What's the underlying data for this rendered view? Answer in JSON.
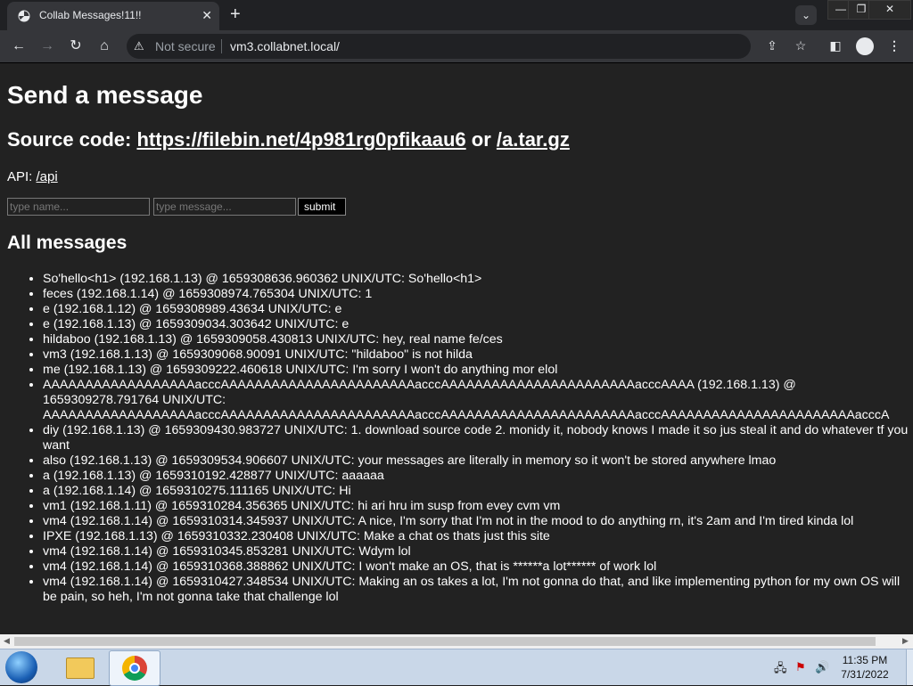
{
  "browser": {
    "tab_title": "Collab Messages!11!!",
    "tab_close": "✕",
    "new_tab": "+",
    "not_secure": "Not secure",
    "url": "vm3.collabnet.local/"
  },
  "page": {
    "heading": "Send a message",
    "source_prefix": "Source code: ",
    "source_link": "https://filebin.net/4p981rg0pfikaau6",
    "source_or": " or ",
    "tar_link": "/a.tar.gz",
    "api_prefix": "API: ",
    "api_link": "/api",
    "name_placeholder": "type name...",
    "message_placeholder": "type message...",
    "submit_label": "submit",
    "all_messages_heading": "All messages",
    "messages": [
      "So'hello<h1> (192.168.1.13) @ 1659308636.960362 UNIX/UTC: So'hello<h1>",
      "feces (192.168.1.14) @ 1659308974.765304 UNIX/UTC: 1",
      "e (192.168.1.12) @ 1659308989.43634 UNIX/UTC: e",
      "e (192.168.1.13) @ 1659309034.303642 UNIX/UTC: e",
      "hildaboo (192.168.1.13) @ 1659309058.430813 UNIX/UTC: hey, real name fe/ces",
      "vm3 (192.168.1.13) @ 1659309068.90091 UNIX/UTC: \"hildaboo\" is not hilda",
      "me (192.168.1.13) @ 1659309222.460618 UNIX/UTC: I'm sorry I won't do anything mor elol",
      "AAAAAAAAAAAAAAAAAAacccAAAAAAAAAAAAAAAAAAAAAAAacccAAAAAAAAAAAAAAAAAAAAAAAacccAAAA (192.168.1.13) @ 1659309278.791764 UNIX/UTC: AAAAAAAAAAAAAAAAAAacccAAAAAAAAAAAAAAAAAAAAAAAacccAAAAAAAAAAAAAAAAAAAAAAAacccAAAAAAAAAAAAAAAAAAAAAAAacccA",
      "diy (192.168.1.13) @ 1659309430.983727 UNIX/UTC: 1. download source code 2. monidy it, nobody knows I made it so jus steal it and do whatever tf you want",
      "also (192.168.1.13) @ 1659309534.906607 UNIX/UTC: your messages are literally in memory so it won't be stored anywhere lmao",
      "a (192.168.1.13) @ 1659310192.428877 UNIX/UTC: aaaaaa",
      "a (192.168.1.14) @ 1659310275.111165 UNIX/UTC: Hi",
      "vm1 (192.168.1.11) @ 1659310284.356365 UNIX/UTC: hi ari hru im susp from evey cvm vm",
      "vm4 (192.168.1.14) @ 1659310314.345937 UNIX/UTC: A nice, I'm sorry that I'm not in the mood to do anything rn, it's 2am and I'm tired kinda lol",
      "IPXE (192.168.1.13) @ 1659310332.230408 UNIX/UTC: Make a chat os thats just this site",
      "vm4 (192.168.1.14) @ 1659310345.853281 UNIX/UTC: Wdym lol",
      "vm4 (192.168.1.14) @ 1659310368.388862 UNIX/UTC: I won't make an OS, that is ******a lot****** of work lol",
      "vm4 (192.168.1.14) @ 1659310427.348534 UNIX/UTC: Making an os takes a lot, I'm not gonna do that, and like implementing python for my own OS will be pain, so heh, I'm not gonna take that challenge lol"
    ]
  },
  "taskbar": {
    "time": "11:35 PM",
    "date": "7/31/2022"
  },
  "icons": {
    "back": "arrow-left-icon",
    "forward": "arrow-right-icon",
    "reload": "reload-icon",
    "home": "home-icon",
    "warning": "warning-icon",
    "share": "share-icon",
    "star": "star-icon",
    "sidepanel": "side-panel-icon",
    "profile": "profile-icon",
    "menu": "kebab-menu-icon"
  }
}
